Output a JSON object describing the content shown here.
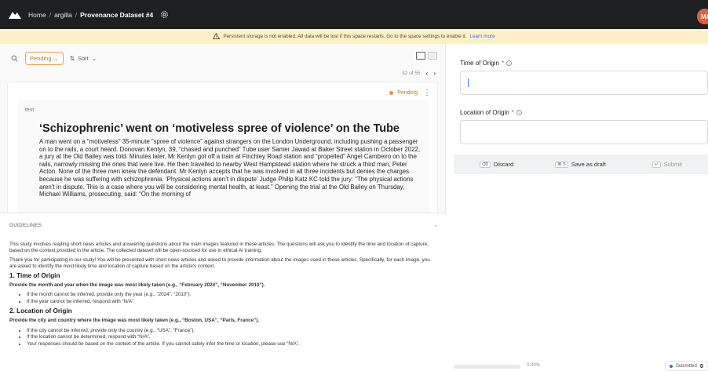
{
  "topbar": {
    "breadcrumbs": [
      "Home",
      "argilla"
    ],
    "dataset": "Provenance Dataset #4",
    "separator": "/",
    "avatar_initials": "MA",
    "avatar_color": "#e2603f"
  },
  "banner": {
    "icon": "warning-triangle-icon",
    "message": "Persistent storage is not enabled. All data will be lost if this space restarts. Go to the space settings to enable it.",
    "link": "Learn more"
  },
  "toolbar": {
    "status_filter": "Pending",
    "sort_label": "Sort",
    "pager_text": "32 of 55"
  },
  "record": {
    "status": "Pending",
    "status_color": "#e29a33",
    "field_name": "text",
    "title": "‘Schizophrenic’ went on ‘motiveless spree of violence’ on the Tube",
    "body": "A man went on a “motiveless” 35-minute “spree of violence” against strangers on the London Underground, including pushing a passenger on to the rails, a court heard. Donovan Kenlyn, 39, “chased and punched” Tube user Samer Jawad at Baker Street station in October 2022, a jury at the Old Bailey was told. Minutes later, Mr Kenlyn got off a train at Finchley Road station and “propelled” Angel Cambeiro on to the rails, narrowly missing the ones that were live. He then travelled to nearby West Hampstead station where he struck a third man, Peter Acton. None of the three men knew the defendant. Mr Kenlyn accepts that he was involved in all three incidents but denies the charges because he was suffering with schizophrenia. ‘Physical actions aren’t in dispute’ Judge Philip Katz KC told the jury: “The physical actions aren’t in dispute. This is a case where you will be considering mental health, at least.” Opening the trial at the Old Bailey on Thursday, Michael Williams, prosecuting, said: “On the morning of"
  },
  "guidelines": {
    "heading": "GUIDELINES",
    "intro": "This study involves reading short news articles and answering questions about the main images featured in these articles. The questions will ask you to identify the time and location of capture, based on the context provided in the article. The collected dataset will be open-sourced for use in ethical AI training.",
    "thanks": "Thank you for participating in our study! You will be presented with short news articles and asked to provide information about the images used in these articles. Specifically, for each image, you are asked to identify the most likely time and location of capture based on the article's context.",
    "sections": [
      {
        "title": "1. Time of Origin",
        "instruction": "Provide the month and year when the image was most likely taken (e.g., “February 2024”, “November 2010”).",
        "bullets": [
          "If the month cannot be inferred, provide only the year (e.g., “2024”, “2010”).",
          "If the year cannot be inferred, respond with “N/A”."
        ]
      },
      {
        "title": "2. Location of Origin",
        "instruction": "Provide the city and country where the image was most likely taken (e.g., “Boston, USA”, “Paris, France”).",
        "bullets": [
          "If the city cannot be inferred, provide only the country (e.g., “USA”, “France”).",
          "If the location cannot be determined, respond with “N/A”.",
          "Your responses should be based on the context of the article. If you cannot safely infer the time or location, please use “N/A”."
        ]
      }
    ]
  },
  "form": {
    "questions": [
      {
        "label": "Time of Origin",
        "required_mark": "*",
        "value": ""
      },
      {
        "label": "Location of Origin",
        "required_mark": "*",
        "value": ""
      }
    ],
    "discard_label": "Discard",
    "discard_key": "⌫",
    "draft_label": "Save as draft",
    "draft_keys": "⌘ S",
    "submit_label": "Submit",
    "submit_key": "↵"
  },
  "progress": {
    "percent_text": "0.00%",
    "fraction": 0,
    "submitted_label": "Submitted",
    "submitted_count": "0"
  }
}
